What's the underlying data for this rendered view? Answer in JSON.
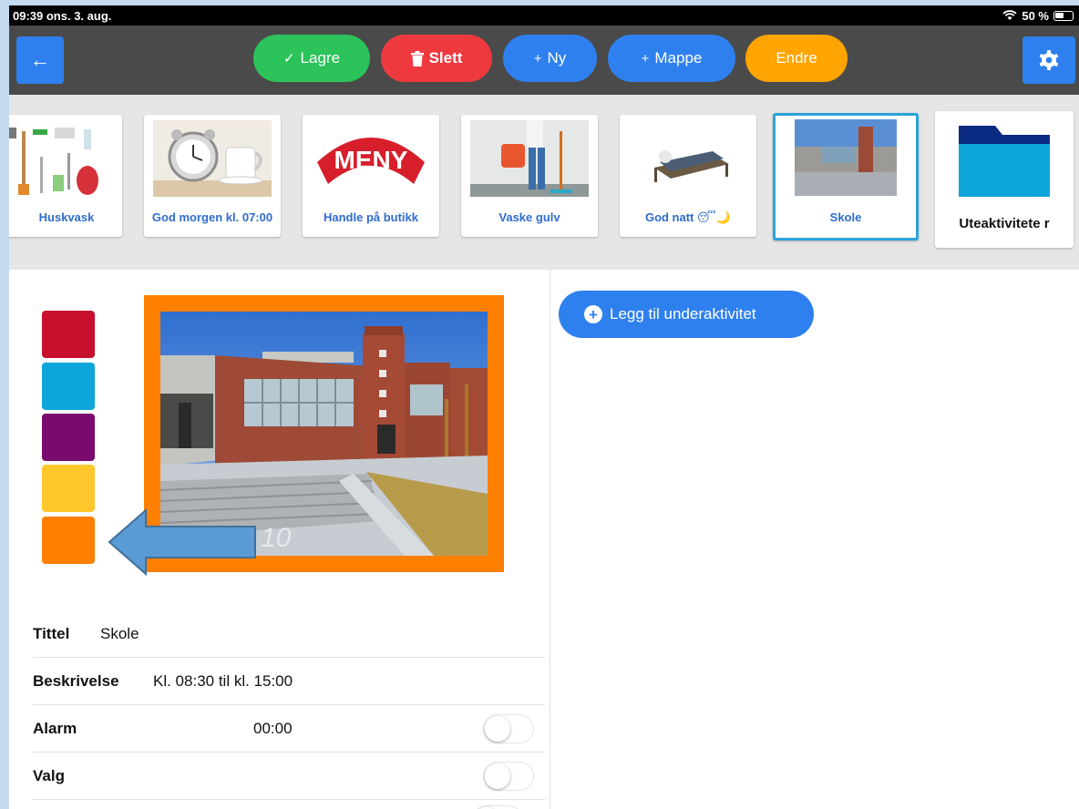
{
  "status_bar": {
    "time_date": "09:39  ons. 3. aug.",
    "battery": "50 %"
  },
  "toolbar": {
    "back_icon": "←",
    "save_label": "Lagre",
    "delete_label": "Slett",
    "new_label": "Ny",
    "folder_label": "Mappe",
    "edit_label": "Endre",
    "colors": {
      "bar": "#4a4a4a",
      "blue": "#2e80ee",
      "green": "#2bc35a",
      "red": "#ee3a3f",
      "orange": "#ffa400"
    }
  },
  "activities": [
    {
      "label": "Huskvask",
      "icon": "cleaning-supplies-icon"
    },
    {
      "label": "God morgen kl. 07:00",
      "icon": "alarm-clock-coffee-icon"
    },
    {
      "label": "Handle på butikk",
      "icon": "meny-store-logo"
    },
    {
      "label": "Vaske gulv",
      "icon": "mopping-floor-icon"
    },
    {
      "label": "God natt 😴🌙",
      "icon": "sleeping-in-bed-icon"
    },
    {
      "label": "Skole",
      "icon": "school-building-photo",
      "selected": true
    },
    {
      "label": "Uteaktivitete r",
      "icon": "folder-icon"
    }
  ],
  "color_picker": [
    "#c8102e",
    "#0ea5d9",
    "#7b0a6e",
    "#ffc72c",
    "#ff7f00"
  ],
  "selected_color": "#ff7f00",
  "add_subactivity_label": "Legg til underaktivitet",
  "form": {
    "title_label": "Tittel",
    "title_value": "Skole",
    "description_label": "Beskrivelse",
    "description_value": "Kl. 08:30 til kl. 15:00",
    "alarm_label": "Alarm",
    "alarm_value": "00:00",
    "alarm_on": false,
    "choice_label": "Valg",
    "choice_on": false
  }
}
